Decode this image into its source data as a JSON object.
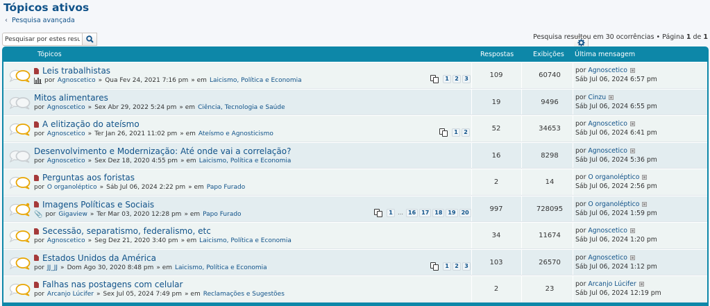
{
  "page": {
    "title": "Tópicos ativos",
    "advanced_search": "Pesquisa avançada",
    "search_placeholder": "Pesquisar por estes resul",
    "results_text": "Pesquisa resultou em 30 ocorrências • Página ",
    "page_current": "1",
    "page_of": " de ",
    "page_total": "1"
  },
  "table_header": {
    "topics": "Tópicos",
    "replies": "Respostas",
    "views": "Exibições",
    "last_post": "Última mensagem"
  },
  "labels": {
    "by": "por",
    "sep": "»",
    "in": "» em"
  },
  "topics": [
    {
      "title": "Leis trabalhistas",
      "read": false,
      "poll": true,
      "attachment": false,
      "author": "Agnoscetico",
      "date": "Qua Fev 24, 2021 7:16 pm",
      "forum": "Laicismo, Política e Economia",
      "pages": [
        "1",
        "2",
        "3"
      ],
      "replies": "109",
      "views": "60740",
      "last_author": "Agnoscetico",
      "last_date": "Sáb Jul 06, 2024 6:57 pm"
    },
    {
      "title": "Mitos alimentares",
      "read": true,
      "poll": false,
      "attachment": false,
      "author": "Agnoscetico",
      "date": "Sex Abr 29, 2022 5:24 pm",
      "forum": "Ciência, Tecnologia e Saúde",
      "pages": [],
      "replies": "19",
      "views": "9496",
      "last_author": "Cinzu",
      "last_date": "Sáb Jul 06, 2024 6:55 pm"
    },
    {
      "title": "A elitização do ateísmo",
      "read": false,
      "poll": false,
      "attachment": false,
      "author": "Agnoscetico",
      "date": "Ter Jan 26, 2021 11:02 pm",
      "forum": "Ateísmo e Agnosticismo",
      "pages": [
        "1",
        "2"
      ],
      "replies": "52",
      "views": "34653",
      "last_author": "Agnoscetico",
      "last_date": "Sáb Jul 06, 2024 6:41 pm"
    },
    {
      "title": "Desenvolvimento e Modernização: Até onde vai a correlação?",
      "read": true,
      "poll": false,
      "attachment": false,
      "author": "Agnoscetico",
      "date": "Sex Dez 18, 2020 4:55 pm",
      "forum": "Laicismo, Política e Economia",
      "pages": [],
      "replies": "16",
      "views": "8298",
      "last_author": "Agnoscetico",
      "last_date": "Sáb Jul 06, 2024 5:36 pm"
    },
    {
      "title": "Perguntas aos foristas",
      "read": false,
      "poll": false,
      "attachment": false,
      "author": "O organoléptico",
      "date": "Sáb Jul 06, 2024 2:22 pm",
      "forum": "Papo Furado",
      "pages": [],
      "replies": "2",
      "views": "14",
      "last_author": "O organoléptico",
      "last_date": "Sáb Jul 06, 2024 2:56 pm"
    },
    {
      "title": "Imagens Políticas e Sociais",
      "read": false,
      "hot": true,
      "poll": false,
      "attachment": true,
      "author": "Gigaview",
      "date": "Ter Mar 03, 2020 12:28 pm",
      "forum": "Papo Furado",
      "pages": [
        "1",
        "…",
        "16",
        "17",
        "18",
        "19",
        "20"
      ],
      "replies": "997",
      "views": "728095",
      "last_author": "O organoléptico",
      "last_date": "Sáb Jul 06, 2024 1:59 pm"
    },
    {
      "title": "Secessão, separatismo, federalismo, etc",
      "read": false,
      "poll": false,
      "attachment": false,
      "author": "Agnoscetico",
      "date": "Seg Dez 21, 2020 3:40 pm",
      "forum": "Laicismo, Política e Economia",
      "pages": [],
      "replies": "34",
      "views": "11674",
      "last_author": "Agnoscetico",
      "last_date": "Sáb Jul 06, 2024 1:20 pm"
    },
    {
      "title": "Estados Unidos da América",
      "read": false,
      "poll": false,
      "attachment": false,
      "author": "JJ_JJ",
      "date": "Dom Ago 30, 2020 8:48 pm",
      "forum": "Laicismo, Política e Economia",
      "pages": [
        "1",
        "2",
        "3"
      ],
      "replies": "103",
      "views": "26570",
      "last_author": "Agnoscetico",
      "last_date": "Sáb Jul 06, 2024 1:12 pm"
    },
    {
      "title": "Falhas nas postagens com celular",
      "read": false,
      "poll": false,
      "attachment": false,
      "author": "Arcanjo Lúcifer",
      "date": "Sex Jul 05, 2024 7:49 pm",
      "forum": "Reclamações e Sugestões",
      "pages": [],
      "replies": "2",
      "views": "23",
      "last_author": "Arcanjo Lúcifer",
      "last_date": "Sáb Jul 06, 2024 12:19 pm"
    }
  ],
  "colors": {
    "header_bg": "#0d87a8",
    "link": "#105289",
    "unread_icon": "#e8a500",
    "read_icon": "#c9ced2"
  }
}
